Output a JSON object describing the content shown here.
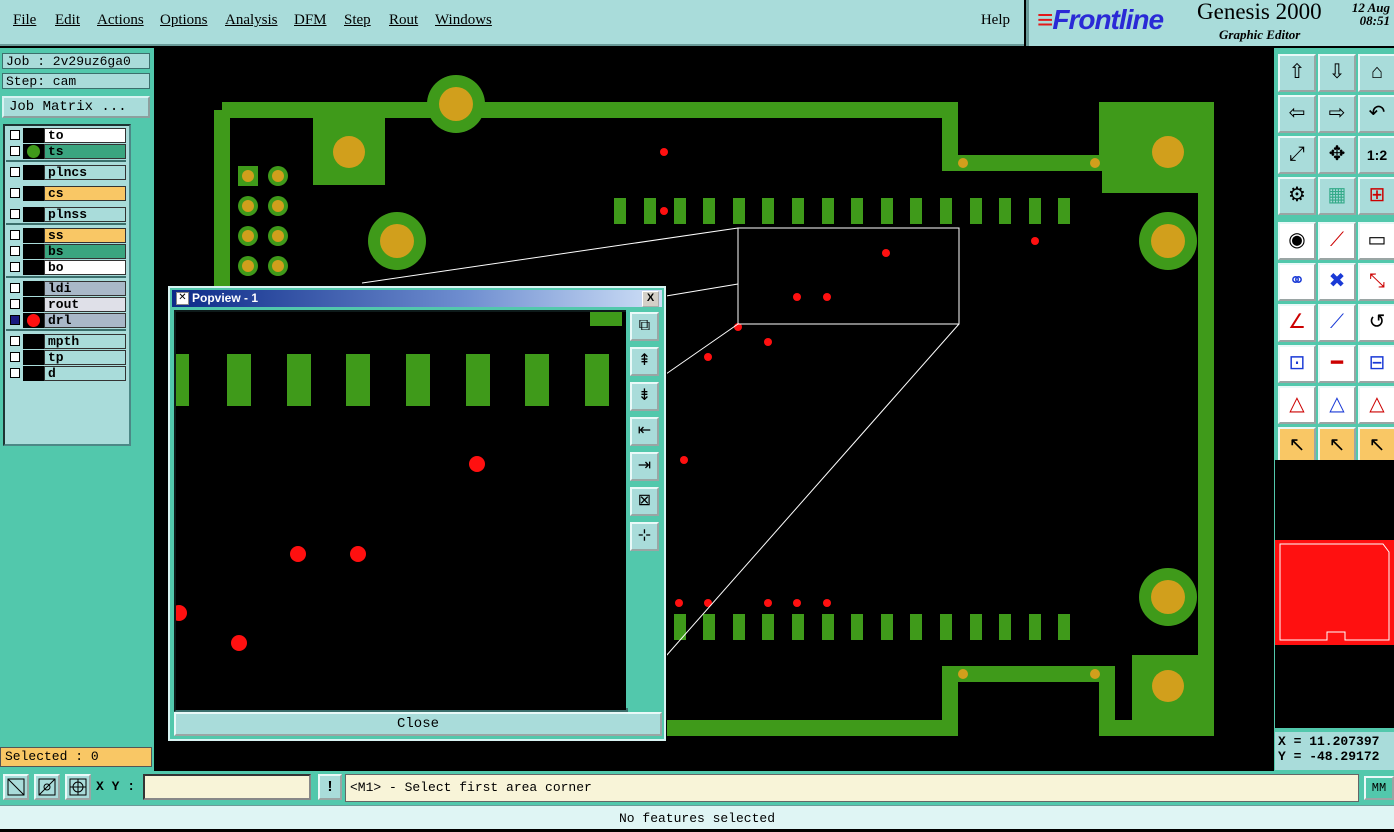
{
  "menubar": {
    "items": [
      "File",
      "Edit",
      "Actions",
      "Options",
      "Analysis",
      "DFM",
      "Step",
      "Rout",
      "Windows"
    ],
    "help": "Help"
  },
  "brand": {
    "logo": "Frontline",
    "product": "Genesis 2000",
    "subtitle": "Graphic Editor",
    "date": "12 Aug",
    "time": "08:51"
  },
  "left_panel": {
    "job": "Job : 2v29uz6ga0",
    "step": "Step: cam",
    "job_matrix": "Job Matrix ...",
    "selected": "Selected : 0",
    "layers": [
      {
        "name": "to",
        "color": "#ffffff",
        "dot": "",
        "checked": false
      },
      {
        "name": "ts",
        "color": "#3aa57f",
        "dot": "#3f9a1a",
        "checked": false
      },
      {
        "name": "plncs",
        "color": "#a9dcda",
        "dot": "",
        "checked": false
      },
      {
        "name": "cs",
        "color": "#f9c765",
        "dot": "",
        "checked": false
      },
      {
        "name": "plnss",
        "color": "#a9dcda",
        "dot": "",
        "checked": false
      },
      {
        "name": "ss",
        "color": "#f9c765",
        "dot": "",
        "checked": false
      },
      {
        "name": "bs",
        "color": "#3aa57f",
        "dot": "",
        "checked": false
      },
      {
        "name": "bo",
        "color": "#ffffff",
        "dot": "",
        "checked": false
      },
      {
        "name": "ldi",
        "color": "#a9b8c8",
        "dot": "",
        "checked": false
      },
      {
        "name": "rout",
        "color": "#dfe0e8",
        "dot": "",
        "checked": false
      },
      {
        "name": "drl",
        "color": "#a9b8c8",
        "dot": "#ff1010",
        "checked": true
      },
      {
        "name": "mpth",
        "color": "#a9dcda",
        "dot": "",
        "checked": false
      },
      {
        "name": "tp",
        "color": "#a9dcda",
        "dot": "",
        "checked": false
      },
      {
        "name": "d",
        "color": "#a9dcda",
        "dot": "",
        "checked": false
      }
    ]
  },
  "popview": {
    "title": "Popview - 1",
    "close": "Close",
    "close_x": "X",
    "tools": [
      "zoom-window-icon",
      "pan-up-icon",
      "pan-down-icon",
      "pan-left-icon",
      "pan-right-icon",
      "zoom-out-icon",
      "zoom-in-icon"
    ]
  },
  "right_toolbar": {
    "buttons": [
      "pan-up-icon",
      "pan-down-icon",
      "home-icon",
      "pan-left-icon",
      "pan-right-icon",
      "undo-zoom-icon",
      "zoom-fit-icon",
      "zoom-center-icon",
      "zoom-1-2-icon",
      "settings-icon",
      "grid-icon",
      "snap-icon",
      "add-feature-icon",
      "line-edit-icon",
      "ruler-icon",
      "connect-icon",
      "delete-icon",
      "move-icon",
      "angle-icon",
      "line-draw-icon",
      "arc-icon",
      "pad-icon",
      "line-icon",
      "measure-icon",
      "triangle-icon",
      "triangle-outline-icon",
      "triangle-edit-icon",
      "select-arrow-icon",
      "select-box-icon",
      "select-circle-icon"
    ],
    "zoom_label": "1:2",
    "x": "X = 11.207397",
    "y": "Y = -48.29172"
  },
  "bottom": {
    "xy_label": "X Y :",
    "xy_value": "",
    "bang": "!",
    "prompt": "<M1> - Select first area corner",
    "units": "MM",
    "status": "No features selected"
  },
  "colors": {
    "copper": "#3f9a1a",
    "pad": "#d19f1c",
    "drill": "#ff1010",
    "panel": "#52c8ac",
    "menu": "#a9dcda"
  }
}
